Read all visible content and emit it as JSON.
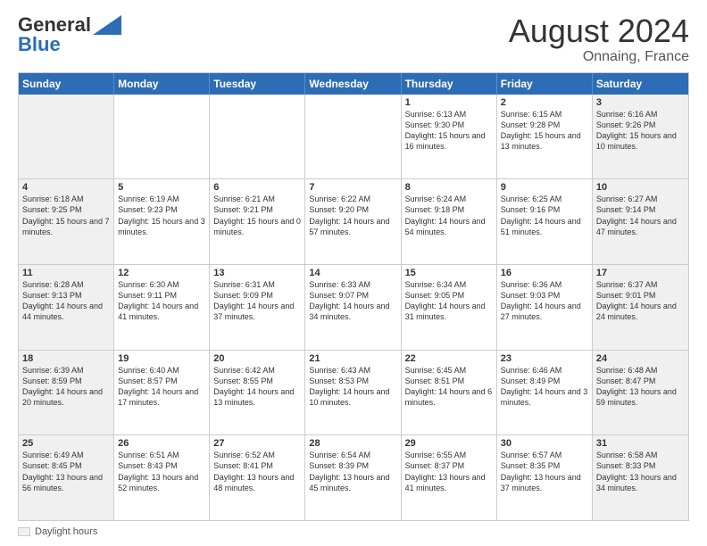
{
  "header": {
    "logo_general": "General",
    "logo_blue": "Blue",
    "month_title": "August 2024",
    "location": "Onnaing, France"
  },
  "day_headers": [
    "Sunday",
    "Monday",
    "Tuesday",
    "Wednesday",
    "Thursday",
    "Friday",
    "Saturday"
  ],
  "footer": {
    "legend_label": "Daylight hours"
  },
  "weeks": [
    [
      {
        "day": "",
        "info": ""
      },
      {
        "day": "",
        "info": ""
      },
      {
        "day": "",
        "info": ""
      },
      {
        "day": "",
        "info": ""
      },
      {
        "day": "1",
        "info": "Sunrise: 6:13 AM\nSunset: 9:30 PM\nDaylight: 15 hours and 16 minutes."
      },
      {
        "day": "2",
        "info": "Sunrise: 6:15 AM\nSunset: 9:28 PM\nDaylight: 15 hours and 13 minutes."
      },
      {
        "day": "3",
        "info": "Sunrise: 6:16 AM\nSunset: 9:26 PM\nDaylight: 15 hours and 10 minutes."
      }
    ],
    [
      {
        "day": "4",
        "info": "Sunrise: 6:18 AM\nSunset: 9:25 PM\nDaylight: 15 hours and 7 minutes."
      },
      {
        "day": "5",
        "info": "Sunrise: 6:19 AM\nSunset: 9:23 PM\nDaylight: 15 hours and 3 minutes."
      },
      {
        "day": "6",
        "info": "Sunrise: 6:21 AM\nSunset: 9:21 PM\nDaylight: 15 hours and 0 minutes."
      },
      {
        "day": "7",
        "info": "Sunrise: 6:22 AM\nSunset: 9:20 PM\nDaylight: 14 hours and 57 minutes."
      },
      {
        "day": "8",
        "info": "Sunrise: 6:24 AM\nSunset: 9:18 PM\nDaylight: 14 hours and 54 minutes."
      },
      {
        "day": "9",
        "info": "Sunrise: 6:25 AM\nSunset: 9:16 PM\nDaylight: 14 hours and 51 minutes."
      },
      {
        "day": "10",
        "info": "Sunrise: 6:27 AM\nSunset: 9:14 PM\nDaylight: 14 hours and 47 minutes."
      }
    ],
    [
      {
        "day": "11",
        "info": "Sunrise: 6:28 AM\nSunset: 9:13 PM\nDaylight: 14 hours and 44 minutes."
      },
      {
        "day": "12",
        "info": "Sunrise: 6:30 AM\nSunset: 9:11 PM\nDaylight: 14 hours and 41 minutes."
      },
      {
        "day": "13",
        "info": "Sunrise: 6:31 AM\nSunset: 9:09 PM\nDaylight: 14 hours and 37 minutes."
      },
      {
        "day": "14",
        "info": "Sunrise: 6:33 AM\nSunset: 9:07 PM\nDaylight: 14 hours and 34 minutes."
      },
      {
        "day": "15",
        "info": "Sunrise: 6:34 AM\nSunset: 9:05 PM\nDaylight: 14 hours and 31 minutes."
      },
      {
        "day": "16",
        "info": "Sunrise: 6:36 AM\nSunset: 9:03 PM\nDaylight: 14 hours and 27 minutes."
      },
      {
        "day": "17",
        "info": "Sunrise: 6:37 AM\nSunset: 9:01 PM\nDaylight: 14 hours and 24 minutes."
      }
    ],
    [
      {
        "day": "18",
        "info": "Sunrise: 6:39 AM\nSunset: 8:59 PM\nDaylight: 14 hours and 20 minutes."
      },
      {
        "day": "19",
        "info": "Sunrise: 6:40 AM\nSunset: 8:57 PM\nDaylight: 14 hours and 17 minutes."
      },
      {
        "day": "20",
        "info": "Sunrise: 6:42 AM\nSunset: 8:55 PM\nDaylight: 14 hours and 13 minutes."
      },
      {
        "day": "21",
        "info": "Sunrise: 6:43 AM\nSunset: 8:53 PM\nDaylight: 14 hours and 10 minutes."
      },
      {
        "day": "22",
        "info": "Sunrise: 6:45 AM\nSunset: 8:51 PM\nDaylight: 14 hours and 6 minutes."
      },
      {
        "day": "23",
        "info": "Sunrise: 6:46 AM\nSunset: 8:49 PM\nDaylight: 14 hours and 3 minutes."
      },
      {
        "day": "24",
        "info": "Sunrise: 6:48 AM\nSunset: 8:47 PM\nDaylight: 13 hours and 59 minutes."
      }
    ],
    [
      {
        "day": "25",
        "info": "Sunrise: 6:49 AM\nSunset: 8:45 PM\nDaylight: 13 hours and 56 minutes."
      },
      {
        "day": "26",
        "info": "Sunrise: 6:51 AM\nSunset: 8:43 PM\nDaylight: 13 hours and 52 minutes."
      },
      {
        "day": "27",
        "info": "Sunrise: 6:52 AM\nSunset: 8:41 PM\nDaylight: 13 hours and 48 minutes."
      },
      {
        "day": "28",
        "info": "Sunrise: 6:54 AM\nSunset: 8:39 PM\nDaylight: 13 hours and 45 minutes."
      },
      {
        "day": "29",
        "info": "Sunrise: 6:55 AM\nSunset: 8:37 PM\nDaylight: 13 hours and 41 minutes."
      },
      {
        "day": "30",
        "info": "Sunrise: 6:57 AM\nSunset: 8:35 PM\nDaylight: 13 hours and 37 minutes."
      },
      {
        "day": "31",
        "info": "Sunrise: 6:58 AM\nSunset: 8:33 PM\nDaylight: 13 hours and 34 minutes."
      }
    ]
  ]
}
